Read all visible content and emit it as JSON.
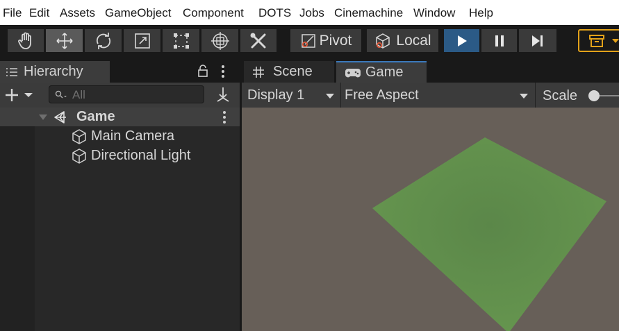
{
  "menu": [
    "File",
    "Edit",
    "Assets",
    "GameObject",
    "Component",
    "DOTS",
    "Jobs",
    "Cinemachine",
    "Window",
    "Help"
  ],
  "toolbar": {
    "pivot_label": "Pivot",
    "local_label": "Local",
    "tools": [
      "hand-tool-icon",
      "move-tool-icon",
      "rotate-tool-icon",
      "scale-tool-icon",
      "rect-tool-icon",
      "transform-tool-icon",
      "custom-tools-icon"
    ],
    "accent_play": "#2b5a86",
    "accent_layers": "#e3a21a"
  },
  "hierarchy": {
    "tab_label": "Hierarchy",
    "search_placeholder": "All",
    "scene_name": "Game",
    "items": [
      "Main Camera",
      "Directional Light"
    ]
  },
  "tabs": {
    "scene_label": "Scene",
    "game_label": "Game"
  },
  "game_view": {
    "display": "Display 1",
    "aspect": "Free Aspect",
    "scale_label": "Scale",
    "background_color": "#675f58",
    "plane_color": "#5f8b4c"
  }
}
